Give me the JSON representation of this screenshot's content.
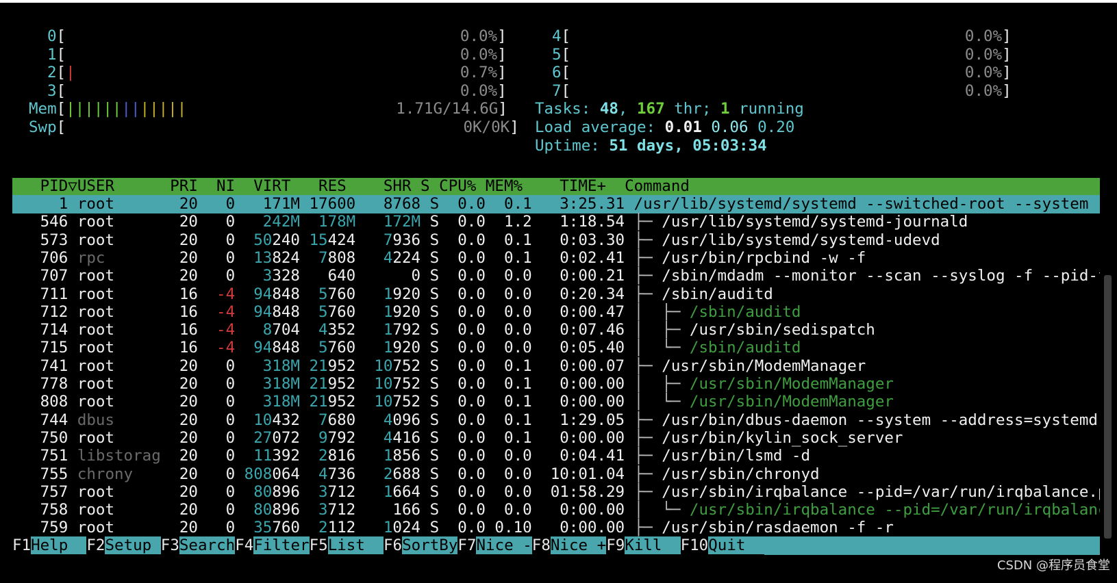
{
  "cpus": [
    {
      "label": "0",
      "bar": "",
      "value": "0.0%"
    },
    {
      "label": "1",
      "bar": "",
      "value": "0.0%"
    },
    {
      "label": "2",
      "bar": "|",
      "value": "0.7%"
    },
    {
      "label": "3",
      "bar": "",
      "value": "0.0%"
    },
    {
      "label": "4",
      "bar": "",
      "value": "0.0%"
    },
    {
      "label": "5",
      "bar": "",
      "value": "0.0%"
    },
    {
      "label": "6",
      "bar": "",
      "value": "0.0%"
    },
    {
      "label": "7",
      "bar": "",
      "value": "0.0%"
    }
  ],
  "mem": {
    "label": "Mem",
    "value": "1.71G/14.6G"
  },
  "swp": {
    "label": "Swp",
    "value": "0K/0K"
  },
  "stats": {
    "tasks_label": "Tasks: ",
    "tasks": "48",
    "threads": "167",
    "thr_label": " thr; ",
    "running": "1",
    "running_label": " running",
    "load_label": "Load average: ",
    "load1": "0.01",
    "load5": "0.06",
    "load15": "0.20",
    "uptime_label": "Uptime: ",
    "uptime": "51 days, 05:03:34"
  },
  "columns": {
    "pid": "PID",
    "sort_marker": "▽",
    "user": "USER",
    "pri": "PRI",
    "ni": "NI",
    "virt": "VIRT",
    "res": "RES",
    "shr": "SHR",
    "s": "S",
    "cpu": "CPU%",
    "mem": "MEM%",
    "time": "TIME+",
    "command": "Command"
  },
  "processes": [
    {
      "pid": "1",
      "user": "root",
      "pri": "20",
      "ni": "0",
      "virt": "171M",
      "res": "17600",
      "shr": "8768",
      "s": "S",
      "cpu": "0.0",
      "mem": "0.1",
      "time": "3:25.31",
      "tree": "",
      "cmd": "/usr/lib/systemd/systemd --switched-root --system -"
    },
    {
      "pid": "546",
      "user": "root",
      "pri": "20",
      "ni": "0",
      "virt": "242M",
      "res": "178M",
      "shr": "172M",
      "s": "S",
      "cpu": "0.0",
      "mem": "1.2",
      "time": "1:18.54",
      "tree": "├─ ",
      "cmd": "/usr/lib/systemd/systemd-journald"
    },
    {
      "pid": "573",
      "user": "root",
      "pri": "20",
      "ni": "0",
      "virt": "50240",
      "res": "15424",
      "shr": "7936",
      "s": "S",
      "cpu": "0.0",
      "mem": "0.1",
      "time": "0:03.30",
      "tree": "├─ ",
      "cmd": "/usr/lib/systemd/systemd-udevd"
    },
    {
      "pid": "706",
      "user": "rpc",
      "pri": "20",
      "ni": "0",
      "virt": "13824",
      "res": "7808",
      "shr": "4224",
      "s": "S",
      "cpu": "0.0",
      "mem": "0.1",
      "time": "0:02.41",
      "tree": "├─ ",
      "cmd": "/usr/bin/rpcbind -w -f"
    },
    {
      "pid": "707",
      "user": "root",
      "pri": "20",
      "ni": "0",
      "virt": "3328",
      "res": "640",
      "shr": "0",
      "s": "S",
      "cpu": "0.0",
      "mem": "0.0",
      "time": "0:00.21",
      "tree": "├─ ",
      "cmd": "/sbin/mdadm --monitor --scan --syslog -f --pid-f"
    },
    {
      "pid": "711",
      "user": "root",
      "pri": "16",
      "ni": "-4",
      "virt": "94848",
      "res": "5760",
      "shr": "1920",
      "s": "S",
      "cpu": "0.0",
      "mem": "0.0",
      "time": "0:20.34",
      "tree": "├─ ",
      "cmd": "/sbin/auditd"
    },
    {
      "pid": "712",
      "user": "root",
      "pri": "16",
      "ni": "-4",
      "virt": "94848",
      "res": "5760",
      "shr": "1920",
      "s": "S",
      "cpu": "0.0",
      "mem": "0.0",
      "time": "0:00.47",
      "tree": "│  ├─ ",
      "cmd": "/sbin/auditd"
    },
    {
      "pid": "714",
      "user": "root",
      "pri": "16",
      "ni": "-4",
      "virt": "8704",
      "res": "4352",
      "shr": "1792",
      "s": "S",
      "cpu": "0.0",
      "mem": "0.0",
      "time": "0:07.46",
      "tree": "│  ├─ ",
      "cmd": "/usr/sbin/sedispatch"
    },
    {
      "pid": "715",
      "user": "root",
      "pri": "16",
      "ni": "-4",
      "virt": "94848",
      "res": "5760",
      "shr": "1920",
      "s": "S",
      "cpu": "0.0",
      "mem": "0.0",
      "time": "0:05.40",
      "tree": "│  └─ ",
      "cmd": "/sbin/auditd"
    },
    {
      "pid": "741",
      "user": "root",
      "pri": "20",
      "ni": "0",
      "virt": "318M",
      "res": "21952",
      "shr": "10752",
      "s": "S",
      "cpu": "0.0",
      "mem": "0.1",
      "time": "0:00.07",
      "tree": "├─ ",
      "cmd": "/usr/sbin/ModemManager"
    },
    {
      "pid": "778",
      "user": "root",
      "pri": "20",
      "ni": "0",
      "virt": "318M",
      "res": "21952",
      "shr": "10752",
      "s": "S",
      "cpu": "0.0",
      "mem": "0.1",
      "time": "0:00.00",
      "tree": "│  ├─ ",
      "cmd": "/usr/sbin/ModemManager"
    },
    {
      "pid": "808",
      "user": "root",
      "pri": "20",
      "ni": "0",
      "virt": "318M",
      "res": "21952",
      "shr": "10752",
      "s": "S",
      "cpu": "0.0",
      "mem": "0.1",
      "time": "0:00.00",
      "tree": "│  └─ ",
      "cmd": "/usr/sbin/ModemManager"
    },
    {
      "pid": "744",
      "user": "dbus",
      "pri": "20",
      "ni": "0",
      "virt": "10432",
      "res": "7680",
      "shr": "4096",
      "s": "S",
      "cpu": "0.0",
      "mem": "0.1",
      "time": "1:29.05",
      "tree": "├─ ",
      "cmd": "/usr/bin/dbus-daemon --system --address=systemd:"
    },
    {
      "pid": "750",
      "user": "root",
      "pri": "20",
      "ni": "0",
      "virt": "27072",
      "res": "9792",
      "shr": "4416",
      "s": "S",
      "cpu": "0.0",
      "mem": "0.1",
      "time": "0:00.00",
      "tree": "├─ ",
      "cmd": "/usr/bin/kylin_sock_server"
    },
    {
      "pid": "751",
      "user": "libstorag",
      "pri": "20",
      "ni": "0",
      "virt": "11392",
      "res": "2816",
      "shr": "1856",
      "s": "S",
      "cpu": "0.0",
      "mem": "0.0",
      "time": "0:04.41",
      "tree": "├─ ",
      "cmd": "/usr/bin/lsmd -d"
    },
    {
      "pid": "755",
      "user": "chrony",
      "pri": "20",
      "ni": "0",
      "virt": "808064",
      "res": "4736",
      "shr": "2688",
      "s": "S",
      "cpu": "0.0",
      "mem": "0.0",
      "time": "10:01.04",
      "tree": "├─ ",
      "cmd": "/usr/sbin/chronyd"
    },
    {
      "pid": "757",
      "user": "root",
      "pri": "20",
      "ni": "0",
      "virt": "80896",
      "res": "3712",
      "shr": "1664",
      "s": "S",
      "cpu": "0.0",
      "mem": "0.0",
      "time": "01:58.29",
      "tree": "├─ ",
      "cmd": "/usr/sbin/irqbalance --pid=/var/run/irqbalance.p"
    },
    {
      "pid": "758",
      "user": "root",
      "pri": "20",
      "ni": "0",
      "virt": "80896",
      "res": "3712",
      "shr": "166",
      "s": "S",
      "cpu": "0.0",
      "mem": "0.0",
      "time": "0:00.00",
      "tree": "│  └─ ",
      "cmd": "/usr/sbin/irqbalance --pid=/var/run/irqbalanc"
    },
    {
      "pid": "759",
      "user": "root",
      "pri": "20",
      "ni": "0",
      "virt": "35760",
      "res": "2112",
      "shr": "1024",
      "s": "S",
      "cpu": "0.0",
      "mem": "0.10",
      "time": "0:00.00",
      "tree": "├─ ",
      "cmd": "/usr/sbin/rasdaemon -f -r"
    }
  ],
  "function_keys": [
    {
      "key": "F1",
      "label": "Help  "
    },
    {
      "key": "F2",
      "label": "Setup "
    },
    {
      "key": "F3",
      "label": "Search"
    },
    {
      "key": "F4",
      "label": "Filter"
    },
    {
      "key": "F5",
      "label": "List  "
    },
    {
      "key": "F6",
      "label": "SortBy"
    },
    {
      "key": "F7",
      "label": "Nice -"
    },
    {
      "key": "F8",
      "label": "Nice +"
    },
    {
      "key": "F9",
      "label": "Kill  "
    },
    {
      "key": "F10",
      "label": "Quit  "
    }
  ],
  "watermark": "CSDN @程序员食堂",
  "colors": {
    "header_bg": "#4ca33b",
    "selected_bg": "#4aa6ad",
    "label_cyan": "#5fc7cf",
    "thread_green": "#6ecf3a",
    "nice_red": "#d23c3c",
    "thread_row_green": "#3f9e3f"
  }
}
